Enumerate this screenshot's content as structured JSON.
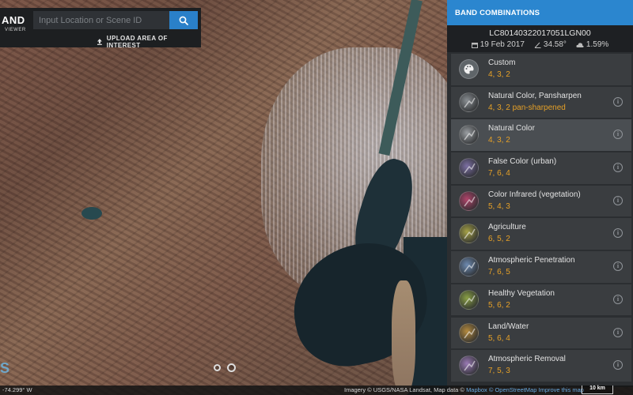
{
  "app": {
    "brand_title": "AND",
    "brand_subtitle": "VIEWER"
  },
  "search": {
    "placeholder": "Input Location or Scene ID",
    "upload_label": "UPLOAD AREA OF INTEREST"
  },
  "panel": {
    "title": "BAND COMBINATIONS",
    "scene_id": "LC80140322017051LGN00",
    "date": "19 Feb 2017",
    "sun_angle": "34.58°",
    "cloud_cover": "1.59%",
    "bands": [
      {
        "name": "Custom",
        "value": "4, 3, 2",
        "color": "#5f6569",
        "info": false
      },
      {
        "name": "Natural Color, Pansharpen",
        "value": "4, 3, 2 pan-sharpened",
        "color": "#8a8f93",
        "info": true
      },
      {
        "name": "Natural Color",
        "value": "4, 3, 2",
        "color": "#9a9ea2",
        "info": true,
        "selected": true
      },
      {
        "name": "False Color (urban)",
        "value": "7, 6, 4",
        "color": "#7c6fa3",
        "info": true
      },
      {
        "name": "Color Infrared (vegetation)",
        "value": "5, 4, 3",
        "color": "#b0446a",
        "info": true
      },
      {
        "name": "Agriculture",
        "value": "6, 5, 2",
        "color": "#a5a146",
        "info": true
      },
      {
        "name": "Atmospheric Penetration",
        "value": "7, 6, 5",
        "color": "#6d8ab0",
        "info": true
      },
      {
        "name": "Healthy Vegetation",
        "value": "5, 6, 2",
        "color": "#8aa045",
        "info": true
      },
      {
        "name": "Land/Water",
        "value": "5, 6, 4",
        "color": "#b48a3e",
        "info": true
      },
      {
        "name": "Atmospheric Removal",
        "value": "7, 5, 3",
        "color": "#9a7ab4",
        "info": true
      }
    ]
  },
  "footer": {
    "coordinate": "-74.299° W",
    "attribution_prefix": "Imagery © USGS/NASA Landsat, Map data ©",
    "mapbox": "Mapbox",
    "osm": "© OpenStreetMap",
    "improve": "Improve this map",
    "scale": "10 km"
  },
  "colors": {
    "accent": "#2b86cf",
    "band_value": "#e5a027"
  }
}
